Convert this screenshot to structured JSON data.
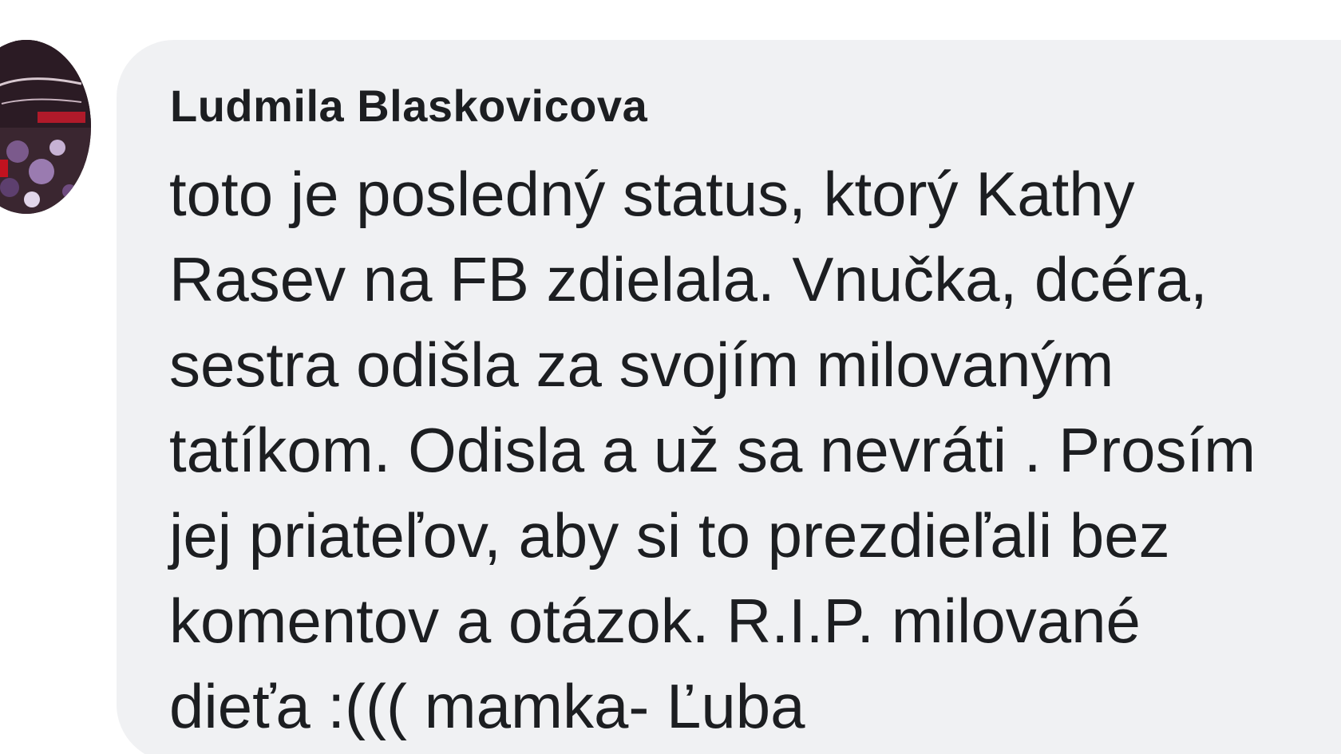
{
  "comment": {
    "author_name": "Ludmila Blaskovicova",
    "text": "toto je posledný status, ktorý Kathy\nRasev na FB zdielala. Vnučka, dcéra,\nsestra odišla za svojím milovaným\ntatíkom. Odisla a už sa nevráti . Prosím\njej priateľov, aby si to prezdieľali bez\nkomentov a otázok.   R.I.P. milované\ndieťa :(((  mamka- Ľuba"
  },
  "colors": {
    "bubble": "#f0f1f3",
    "text": "#1c1e21",
    "background": "#ffffff"
  }
}
